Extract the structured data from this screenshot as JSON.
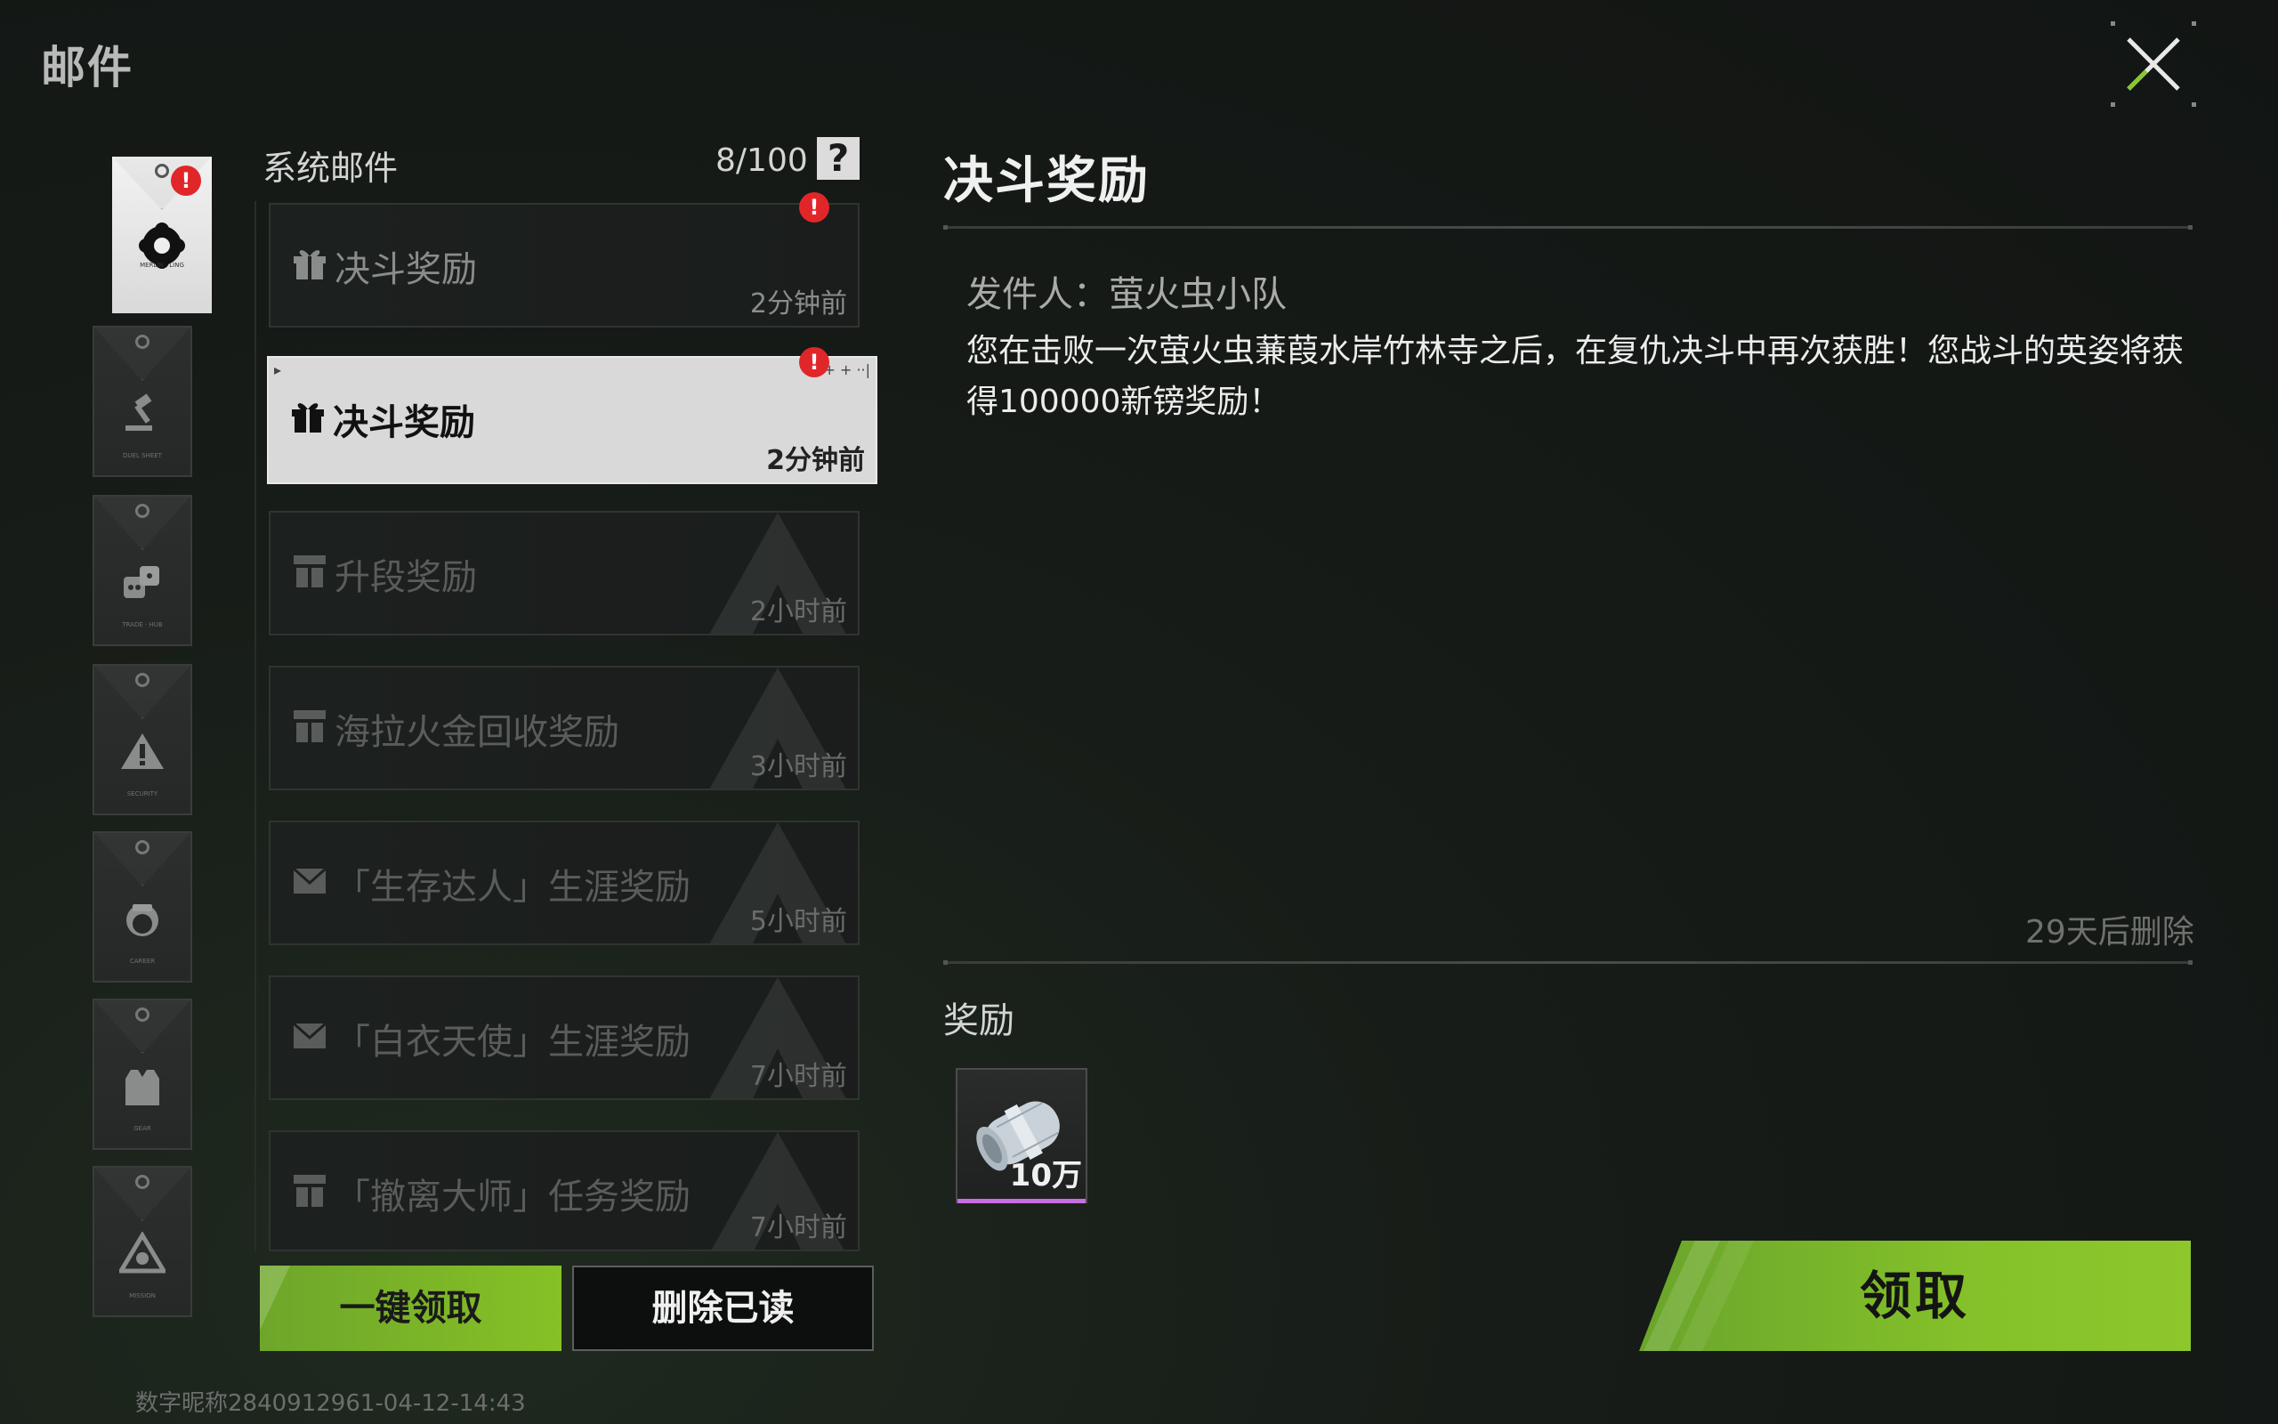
{
  "header": {
    "title": "邮件"
  },
  "list": {
    "title": "系统邮件",
    "count": "8/100",
    "help_symbol": "?",
    "items": [
      {
        "title": "决斗奖励",
        "time": "2分钟前",
        "icon": "gift-icon",
        "unread": true
      },
      {
        "title": "决斗奖励",
        "time": "2分钟前",
        "icon": "gift-icon",
        "unread": true,
        "selected": true
      },
      {
        "title": "升段奖励",
        "time": "2小时前",
        "icon": "gift-open-icon"
      },
      {
        "title": "海拉火金回收奖励",
        "time": "3小时前",
        "icon": "gift-open-icon"
      },
      {
        "title": "「生存达人」生涯奖励",
        "time": "5小时前",
        "icon": "envelope-open-icon"
      },
      {
        "title": "「白衣天使」生涯奖励",
        "time": "7小时前",
        "icon": "envelope-open-icon"
      },
      {
        "title": "「撤离大师」任务奖励",
        "time": "7小时前",
        "icon": "gift-open-icon"
      }
    ],
    "claim_all_label": "一键领取",
    "delete_read_label": "删除已读"
  },
  "categories": [
    {
      "icon": "gear-flower-icon",
      "active": true,
      "badge": "!"
    },
    {
      "icon": "gavel-icon"
    },
    {
      "icon": "dice-icon"
    },
    {
      "icon": "warning-icon"
    },
    {
      "icon": "nurse-icon"
    },
    {
      "icon": "vest-icon"
    },
    {
      "icon": "triangle-eye-icon"
    }
  ],
  "detail": {
    "title": "决斗奖励",
    "sender": "发件人：萤火虫小队",
    "body": "您在击败一次萤火虫蒹葭水岸竹林寺之后，在复仇决斗中再次获胜！您战斗的英姿将获得100000新镑奖励！",
    "expire": "29天后删除",
    "rewards_label": "奖励",
    "rewards": [
      {
        "icon": "cash-roll-icon",
        "quantity": "10万",
        "quality_color": "#c56fe0"
      }
    ],
    "claim_label": "领取"
  },
  "footer": {
    "watermark": "数字昵称2840912961-04-12-14:43"
  },
  "colors": {
    "accent_green": "#7fb82a",
    "badge_red": "#e1262a"
  }
}
